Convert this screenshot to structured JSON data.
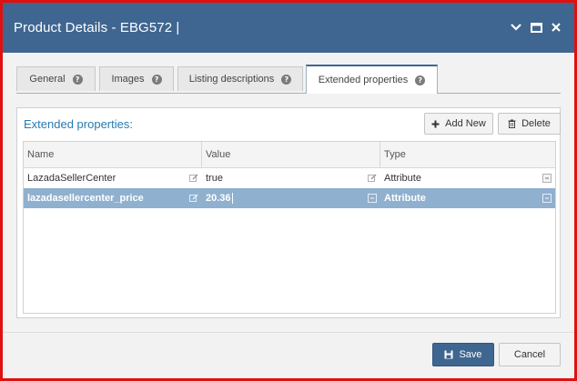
{
  "window": {
    "title": "Product Details - EBG572 |",
    "controls": [
      "chevron-down-icon",
      "maximize-icon",
      "close-icon"
    ]
  },
  "tabs": [
    {
      "label": "General",
      "active": false
    },
    {
      "label": "Images",
      "active": false
    },
    {
      "label": "Listing descriptions",
      "active": false
    },
    {
      "label": "Extended properties",
      "active": true
    }
  ],
  "panel": {
    "title": "Extended properties:",
    "add_label": "Add New",
    "delete_label": "Delete"
  },
  "grid": {
    "columns": [
      "Name",
      "Value",
      "Type"
    ],
    "rows": [
      {
        "name": "LazadaSellerCenter",
        "value": "true",
        "type": "Attribute",
        "selected": false
      },
      {
        "name": "lazadasellercenter_price",
        "value": "20.36",
        "type": "Attribute",
        "selected": true
      }
    ]
  },
  "footer": {
    "save_label": "Save",
    "cancel_label": "Cancel"
  },
  "colors": {
    "titlebar": "#3f6690",
    "accent_text": "#2a7ab0",
    "selected_row": "#8fb0cf",
    "frame_border": "#e01010"
  }
}
